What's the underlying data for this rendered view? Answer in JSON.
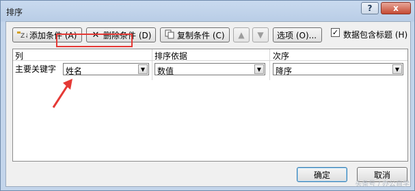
{
  "window": {
    "title": "排序",
    "help_label": "?",
    "close_label": "x"
  },
  "toolbar": {
    "add_label": "添加条件 (A)",
    "delete_label": "删除条件 (D)",
    "copy_label": "复制条件 (C)",
    "up_label": "▲",
    "down_label": "▼",
    "options_label": "选项 (O)...",
    "header_checkbox_label": "数据包含标题 (H)",
    "header_checkbox_checked": true
  },
  "grid": {
    "headers": [
      "列",
      "排序依据",
      "次序"
    ],
    "rows": [
      {
        "label": "主要关键字",
        "column": "姓名",
        "sort_on": "数值",
        "order": "降序"
      }
    ]
  },
  "footer": {
    "ok_label": "确定",
    "cancel_label": "取消"
  },
  "watermark": "头条号 / 办公自学",
  "colors": {
    "highlight": "#e53935",
    "titlebar": "#c9daef"
  }
}
